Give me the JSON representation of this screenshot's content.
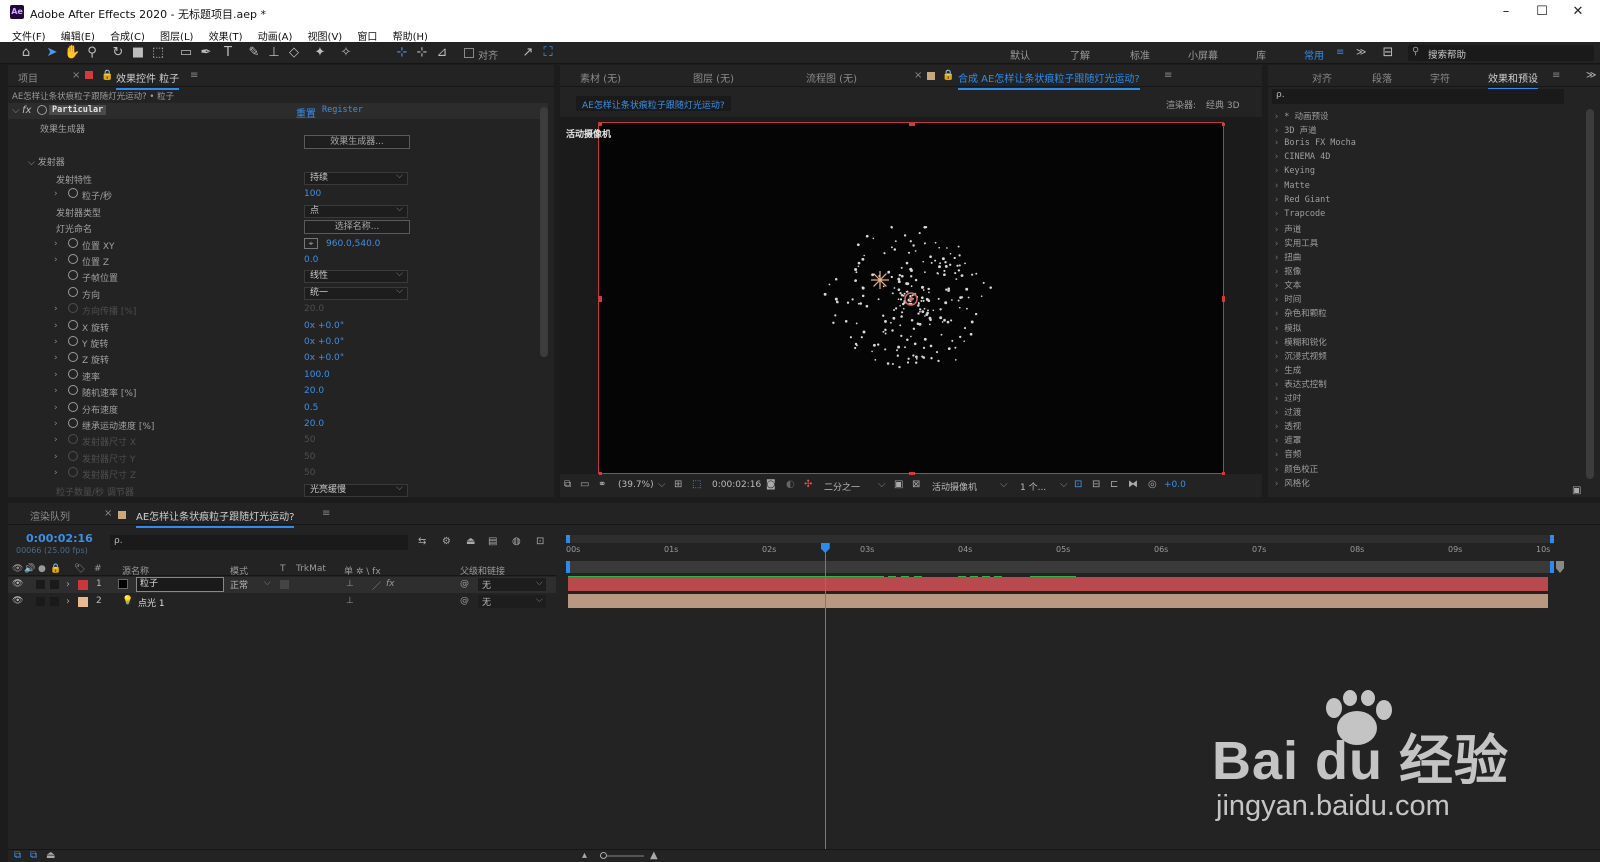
{
  "window": {
    "app_icon": "Ae",
    "title": "Adobe After Effects 2020 - 无标题项目.aep *",
    "minimize": "–",
    "maximize": "☐",
    "close": "✕"
  },
  "menu": [
    "文件(F)",
    "编辑(E)",
    "合成(C)",
    "图层(L)",
    "效果(T)",
    "动画(A)",
    "视图(V)",
    "窗口",
    "帮助(H)"
  ],
  "toolbar": {
    "snap_label": "对齐",
    "workspaces": [
      "默认",
      "了解",
      "标准",
      "小屏幕",
      "库",
      "常用"
    ],
    "active_workspace": "常用",
    "more": "≫",
    "search_placeholder": "搜索帮助"
  },
  "left_panel": {
    "tabs": {
      "project": "项目",
      "effects_controls": "效果控件 粒子"
    },
    "breadcrumb": "AE怎样让条状痕粒子跟随灯光运动? • 粒子",
    "effect_name": "Particular",
    "reset": "重置",
    "register": "Register",
    "effect_builder_label": "效果生成器",
    "effect_builder_button": "效果生成器...",
    "emitter_group": "发射器",
    "properties": [
      {
        "label": "发射特性",
        "kind": "dropdown",
        "value": "持续"
      },
      {
        "label": "粒子/秒",
        "kind": "value",
        "value": "100"
      },
      {
        "label": "发射器类型",
        "kind": "dropdown",
        "value": "点"
      },
      {
        "label": "灯光命名",
        "kind": "button",
        "value": "选择名称..."
      },
      {
        "label": "位置 XY",
        "kind": "value",
        "value": "960.0,540.0"
      },
      {
        "label": "位置 Z",
        "kind": "value",
        "value": "0.0"
      },
      {
        "label": "子帧位置",
        "kind": "dropdown",
        "value": "线性"
      },
      {
        "label": "方向",
        "kind": "dropdown",
        "value": "统一"
      },
      {
        "label": "方向传播 [%]",
        "kind": "value",
        "value": "20.0",
        "dim": true
      },
      {
        "label": "X 旋转",
        "kind": "value",
        "value": "0x +0.0°"
      },
      {
        "label": "Y 旋转",
        "kind": "value",
        "value": "0x +0.0°"
      },
      {
        "label": "Z 旋转",
        "kind": "value",
        "value": "0x +0.0°"
      },
      {
        "label": "速率",
        "kind": "value",
        "value": "100.0"
      },
      {
        "label": "随机速率 [%]",
        "kind": "value",
        "value": "20.0"
      },
      {
        "label": "分布速度",
        "kind": "value",
        "value": "0.5"
      },
      {
        "label": "继承运动速度 [%]",
        "kind": "value",
        "value": "20.0"
      },
      {
        "label": "发射器尺寸 X",
        "kind": "value",
        "value": "50",
        "dim": true
      },
      {
        "label": "发射器尺寸 Y",
        "kind": "value",
        "value": "50",
        "dim": true
      },
      {
        "label": "发射器尺寸 Z",
        "kind": "value",
        "value": "50",
        "dim": true
      },
      {
        "label": "粒子数量/秒 调节器",
        "kind": "dropdown",
        "value": "光亮缓慢",
        "dim": true
      }
    ]
  },
  "viewer": {
    "tabs": [
      "素材 (无)",
      "图层 (无)",
      "流程图 (无)"
    ],
    "comp_tab": "合成 AE怎样让条状痕粒子跟随灯光运动?",
    "comp_chip": "AE怎样让条状痕粒子跟随灯光运动?",
    "renderer_label": "渲染器:",
    "renderer_value": "经典 3D",
    "camera_label": "活动摄像机",
    "zoom": "(39.7%)",
    "timecode": "0:00:02:16",
    "resolution": "二分之一",
    "view": "活动摄像机",
    "views_count": "1 个...",
    "exposure": "+0.0"
  },
  "effects_panel": {
    "tabs": [
      "对齐",
      "段落",
      "字符",
      "效果和预设"
    ],
    "active_tab": "效果和预设",
    "search_placeholder": "ρ.",
    "items": [
      "* 动画预设",
      "3D 声道",
      "Boris FX Mocha",
      "CINEMA 4D",
      "Keying",
      "Matte",
      "Red Giant",
      "Trapcode",
      "声道",
      "实用工具",
      "扭曲",
      "抠像",
      "文本",
      "时间",
      "杂色和颗粒",
      "模拟",
      "模糊和锐化",
      "沉浸式视频",
      "生成",
      "表达式控制",
      "过时",
      "过渡",
      "透视",
      "遮罩",
      "音频",
      "颜色校正",
      "风格化"
    ]
  },
  "timeline": {
    "tabs": {
      "render_queue": "渲染队列",
      "comp": "AE怎样让条状痕粒子跟随灯光运动?"
    },
    "timecode": "0:00:02:16",
    "frame_info": "00066 (25.00 fps)",
    "search_placeholder": "ρ.",
    "headers": {
      "num": "#",
      "source": "源名称",
      "mode": "模式",
      "t": "T",
      "trkmat": "TrkMat",
      "switches": "单 ✲ \\ fx",
      "parent": "父级和链接"
    },
    "layers": [
      {
        "num": "1",
        "name": "粒子",
        "mode": "正常",
        "parent": "无",
        "color": "#c8373a",
        "bar": "#b84a4e"
      },
      {
        "num": "2",
        "name": "点光 1",
        "mode": "",
        "parent": "无",
        "color": "#e8b890",
        "bar": "#b89880"
      }
    ],
    "ruler": [
      "00s",
      "01s",
      "02s",
      "03s",
      "04s",
      "05s",
      "06s",
      "07s",
      "08s",
      "09s",
      "10s"
    ],
    "playhead_seconds": 2.64
  },
  "watermark": {
    "brand": "Bai du 经验",
    "url": "jingyan.baidu.com"
  }
}
